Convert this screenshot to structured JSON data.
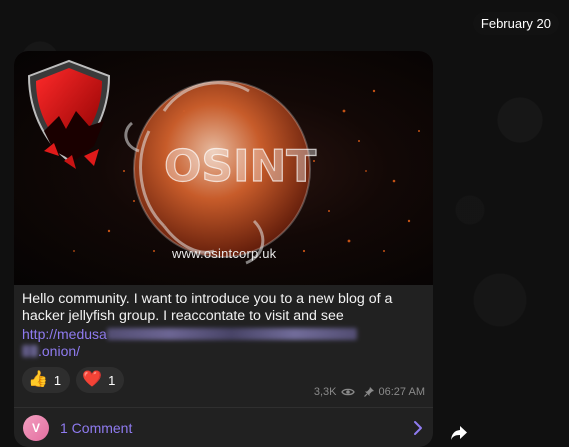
{
  "chat": {
    "date_divider": "February 20"
  },
  "message": {
    "media": {
      "watermark": "www.osintcorp.uk",
      "logo_text": "OSINT"
    },
    "text": "Hello community. I want to introduce you to a new blog of a hacker jellyfish group. I reaccontate to visit and see",
    "link": {
      "prefix": "http://medusa",
      "suffix": ".onion/"
    },
    "reactions": [
      {
        "emoji": "👍",
        "count": "1",
        "icon": "thumbs-up-icon"
      },
      {
        "emoji": "❤️",
        "count": "1",
        "icon": "heart-icon"
      }
    ],
    "views": "3,3K",
    "time": "06:27 AM",
    "comments": {
      "avatar_initial": "V",
      "label": "1 Comment"
    }
  },
  "colors": {
    "accent": "#8f7bf0",
    "bubble": "#212121",
    "avatar": "#e98db3"
  }
}
